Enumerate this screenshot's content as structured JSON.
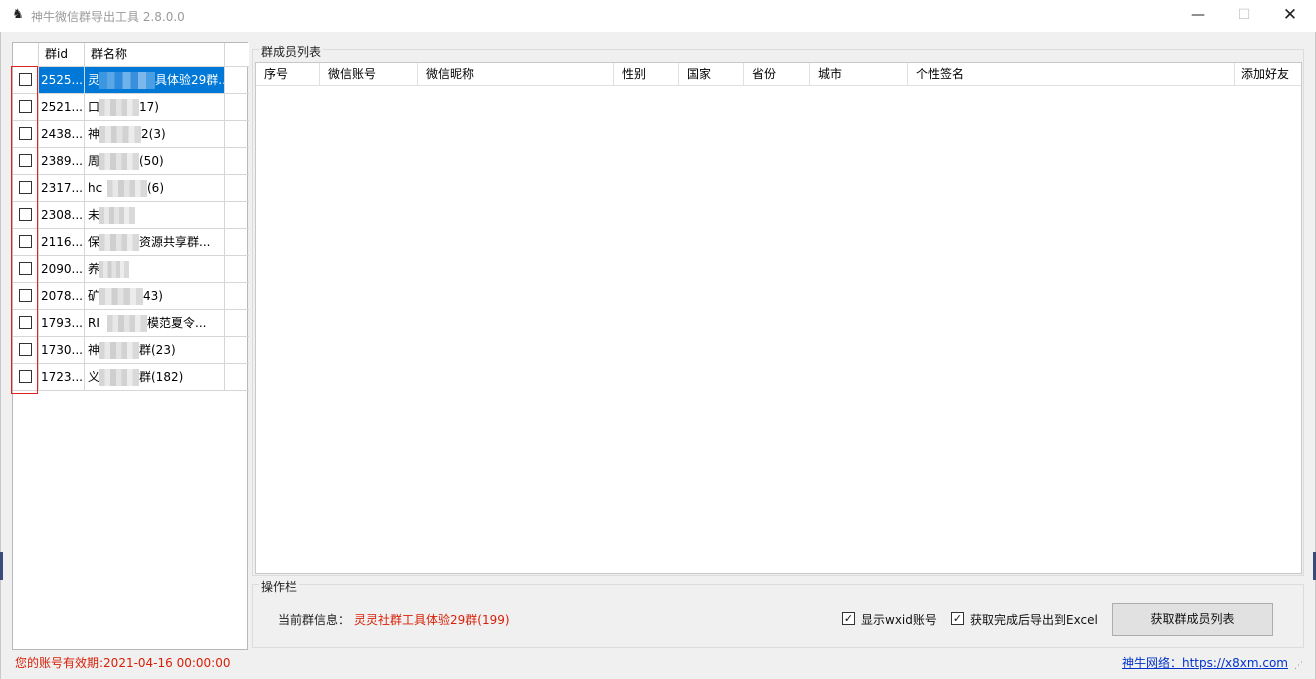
{
  "window": {
    "title": "神牛微信群导出工具 2.8.0.0",
    "minimize": "—",
    "maximize": "☐",
    "close": "✕"
  },
  "group_list": {
    "columns": [
      "群id",
      "群名称"
    ],
    "rows": [
      {
        "id": "2525...",
        "name_visible": "灵",
        "name_tail": "具体验29群...",
        "selected": true,
        "checked": false
      },
      {
        "id": "2521...",
        "name_visible": "口",
        "name_tail": "17)",
        "selected": false,
        "checked": false
      },
      {
        "id": "2438...",
        "name_visible": "神",
        "name_tail": "2(3)",
        "selected": false,
        "checked": false
      },
      {
        "id": "2389...",
        "name_visible": "周",
        "name_tail": "(50)",
        "selected": false,
        "checked": false
      },
      {
        "id": "2317...",
        "name_visible": "hc",
        "name_tail": "(6)",
        "selected": false,
        "checked": false
      },
      {
        "id": "2308...",
        "name_visible": "未",
        "name_tail": "",
        "selected": false,
        "checked": false
      },
      {
        "id": "2116...",
        "name_visible": "保",
        "name_tail": "资源共享群...",
        "selected": false,
        "checked": false
      },
      {
        "id": "2090...",
        "name_visible": "养",
        "name_tail": "",
        "selected": false,
        "checked": false
      },
      {
        "id": "2078...",
        "name_visible": "矿",
        "name_tail": "43)",
        "selected": false,
        "checked": false
      },
      {
        "id": "1793...",
        "name_visible": "RI",
        "name_tail": "模范夏令...",
        "selected": false,
        "checked": false
      },
      {
        "id": "1730...",
        "name_visible": "神",
        "name_tail": "群(23)",
        "selected": false,
        "checked": false
      },
      {
        "id": "1723...",
        "name_visible": "义",
        "name_tail": "群(182)",
        "selected": false,
        "checked": false
      }
    ]
  },
  "members": {
    "group_title": "群成员列表",
    "columns": [
      "序号",
      "微信账号",
      "微信昵称",
      "性别",
      "国家",
      "省份",
      "城市",
      "个性签名",
      "添加好友"
    ],
    "rows": []
  },
  "operations": {
    "group_title": "操作栏",
    "current_group_label": "当前群信息：",
    "current_group_value": "灵灵社群工具体验29群(199)",
    "show_wxid_label": "显示wxid账号",
    "show_wxid_checked": true,
    "export_excel_label": "获取完成后导出到Excel",
    "export_excel_checked": true,
    "fetch_button": "获取群成员列表"
  },
  "status": {
    "expiry": "您的账号有效期:2021-04-16 00:00:00",
    "link": "神牛网络：https://x8xm.com"
  },
  "icons": {
    "app": "bull-icon",
    "resize": "resize-grip-icon"
  },
  "colors": {
    "selection": "#0078d7",
    "alert_red": "#d81e06",
    "link_blue": "#0033cc"
  }
}
